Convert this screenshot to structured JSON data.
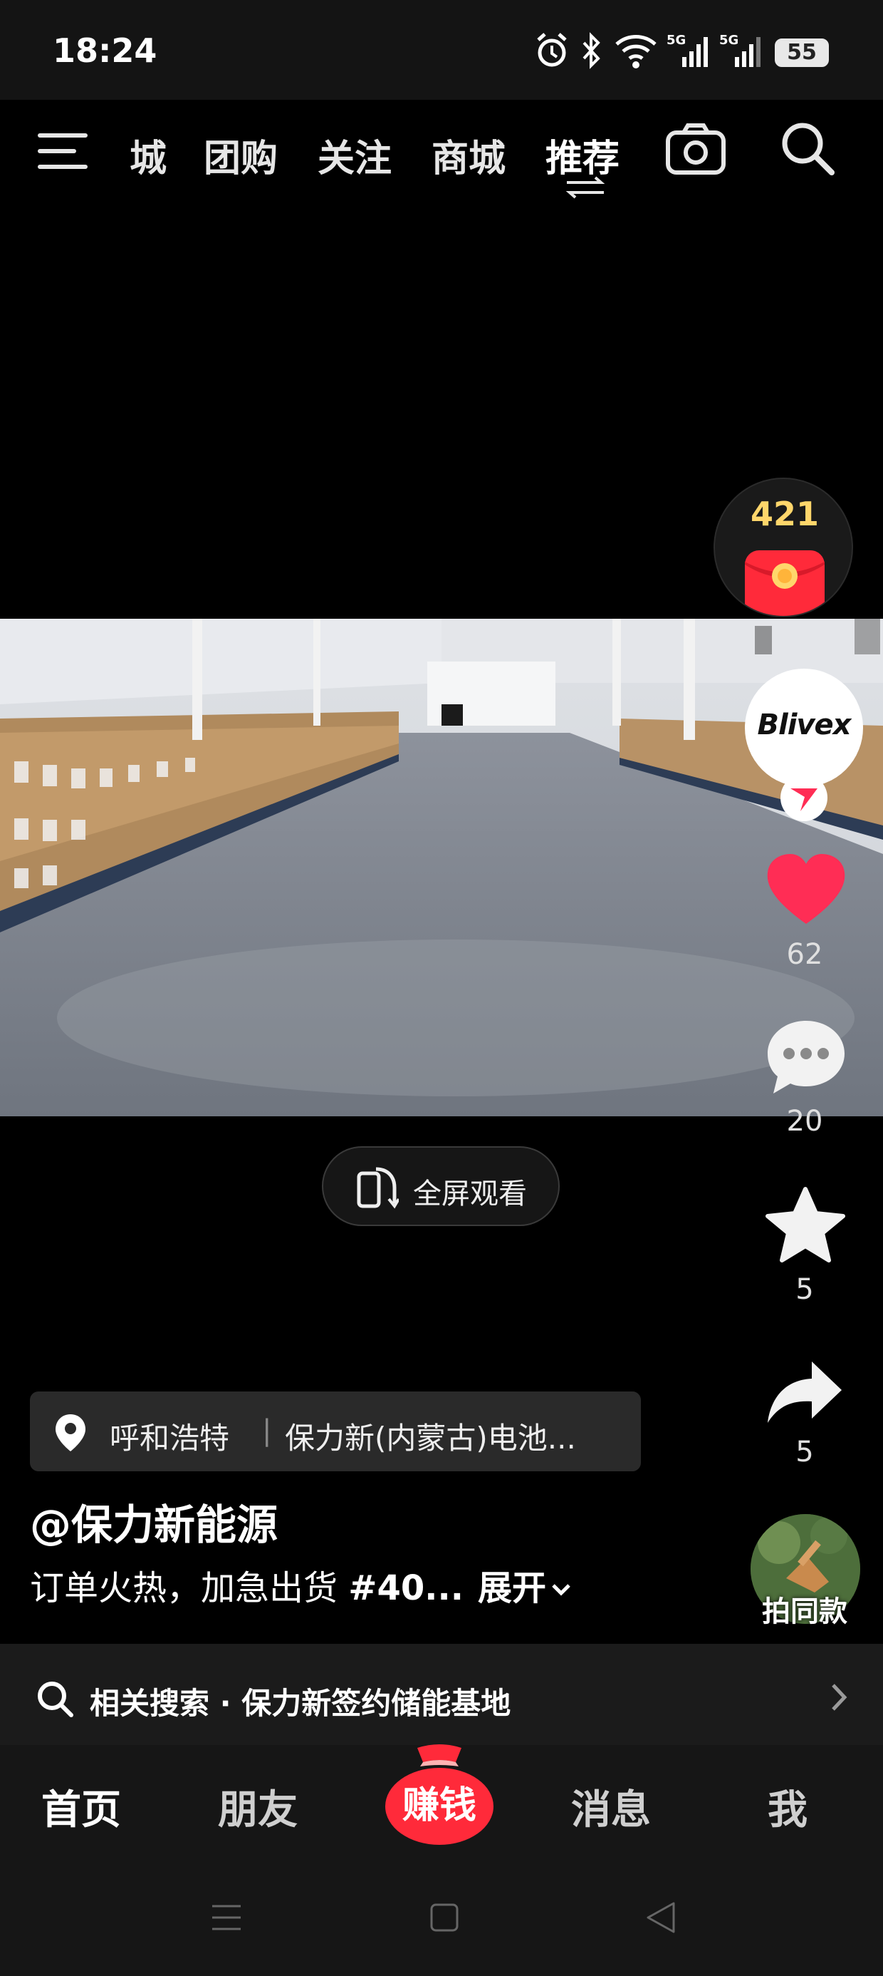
{
  "status_bar": {
    "time": "18:24",
    "battery": "55",
    "icons": [
      "alarm-icon",
      "bluetooth-icon",
      "wifi-icon",
      "signal-5g-icon",
      "signal-5g-icon",
      "battery-icon"
    ]
  },
  "top_nav": {
    "menu_icon": "menu-icon",
    "tabs": [
      "城",
      "团购",
      "关注",
      "商城",
      "推荐"
    ],
    "active_tab": "推荐",
    "camera_icon": "camera-icon",
    "search_icon": "search-icon"
  },
  "rail": {
    "red_packet_count": "421",
    "avatar_text": "Blivex",
    "like_count": "62",
    "comment_count": "20",
    "favorite_count": "5",
    "share_count": "5",
    "same_style_label": "拍同款"
  },
  "video": {
    "fullscreen_label": "全屏观看"
  },
  "info": {
    "location_city": "呼和浩特",
    "location_separator": "|",
    "location_place": "保力新(内蒙古)电池...",
    "author": "@保力新能源",
    "caption_text": "订单火热，加急出货 ",
    "caption_tag": "#40...",
    "caption_expand": "展开"
  },
  "related_search": {
    "text": "相关搜索 · 保力新签约储能基地"
  },
  "bottom_tabs": {
    "home": "首页",
    "friends": "朋友",
    "earn": "赚钱",
    "messages": "消息",
    "me": "我"
  },
  "colors": {
    "like_red": "#ff2d55",
    "earn_red": "#ff2a3a",
    "background": "#000000"
  }
}
